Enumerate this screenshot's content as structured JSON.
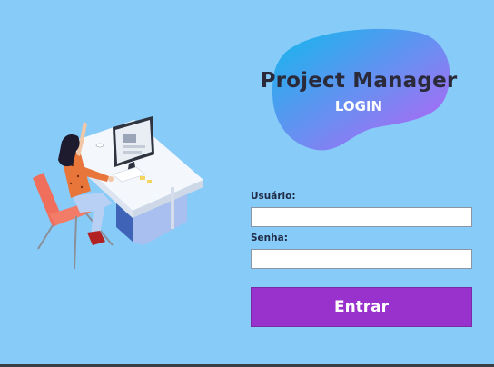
{
  "app": {
    "title": "Project Manager",
    "subtitle": "LOGIN"
  },
  "form": {
    "username_label": "Usuário:",
    "username_value": "",
    "password_label": "Senha:",
    "password_value": "",
    "submit_label": "Entrar"
  },
  "colors": {
    "background": "#87cbf9",
    "button": "#9932cc",
    "blob_gradient_start": "#12b8ec",
    "blob_gradient_end": "#c05cf5"
  },
  "illustration": {
    "icon": "person-at-computer-illustration"
  }
}
